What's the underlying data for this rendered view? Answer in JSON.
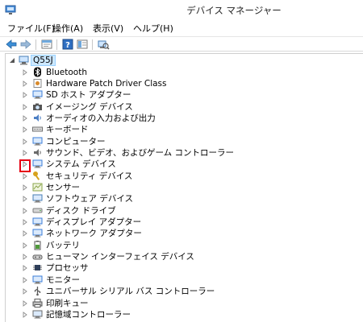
{
  "window": {
    "title": "デバイス マネージャー"
  },
  "menu": {
    "items": [
      "ファイル(F)",
      "操作(A)",
      "表示(V)",
      "ヘルプ(H)"
    ]
  },
  "toolbar": {
    "buttons": [
      "back-arrow-icon",
      "forward-arrow-icon",
      "properties-icon",
      "help-icon",
      "view-icon",
      "scan-hardware-icon"
    ]
  },
  "tree": {
    "root": "Q55J",
    "items": [
      {
        "label": "Bluetooth",
        "icon": "bluetooth-icon"
      },
      {
        "label": "Hardware Patch Driver Class",
        "icon": "driver-class-icon"
      },
      {
        "label": "SD ホスト アダプター",
        "icon": "sd-host-icon"
      },
      {
        "label": "イメージング デバイス",
        "icon": "camera-icon"
      },
      {
        "label": "オーディオの入力および出力",
        "icon": "audio-icon"
      },
      {
        "label": "キーボード",
        "icon": "keyboard-icon"
      },
      {
        "label": "コンピューター",
        "icon": "computer-icon"
      },
      {
        "label": "サウンド、ビデオ、およびゲーム コントローラー",
        "icon": "sound-icon"
      },
      {
        "label": "システム デバイス",
        "icon": "system-device-icon"
      },
      {
        "label": "セキュリティ デバイス",
        "icon": "key-icon"
      },
      {
        "label": "センサー",
        "icon": "sensor-icon"
      },
      {
        "label": "ソフトウェア デバイス",
        "icon": "software-device-icon"
      },
      {
        "label": "ディスク ドライブ",
        "icon": "disk-drive-icon"
      },
      {
        "label": "ディスプレイ アダプター",
        "icon": "display-adapter-icon"
      },
      {
        "label": "ネットワーク アダプター",
        "icon": "network-adapter-icon"
      },
      {
        "label": "バッテリ",
        "icon": "battery-icon"
      },
      {
        "label": "ヒューマン インターフェイス デバイス",
        "icon": "hid-icon"
      },
      {
        "label": "プロセッサ",
        "icon": "processor-icon"
      },
      {
        "label": "モニター",
        "icon": "monitor-icon"
      },
      {
        "label": "ユニバーサル シリアル バス コントローラー",
        "icon": "usb-icon"
      },
      {
        "label": "印刷キュー",
        "icon": "printer-icon"
      },
      {
        "label": "記憶域コントローラー",
        "icon": "storage-controller-icon"
      }
    ]
  },
  "colors": {
    "highlight_box": "#e60012",
    "selection": "#cce8ff"
  }
}
